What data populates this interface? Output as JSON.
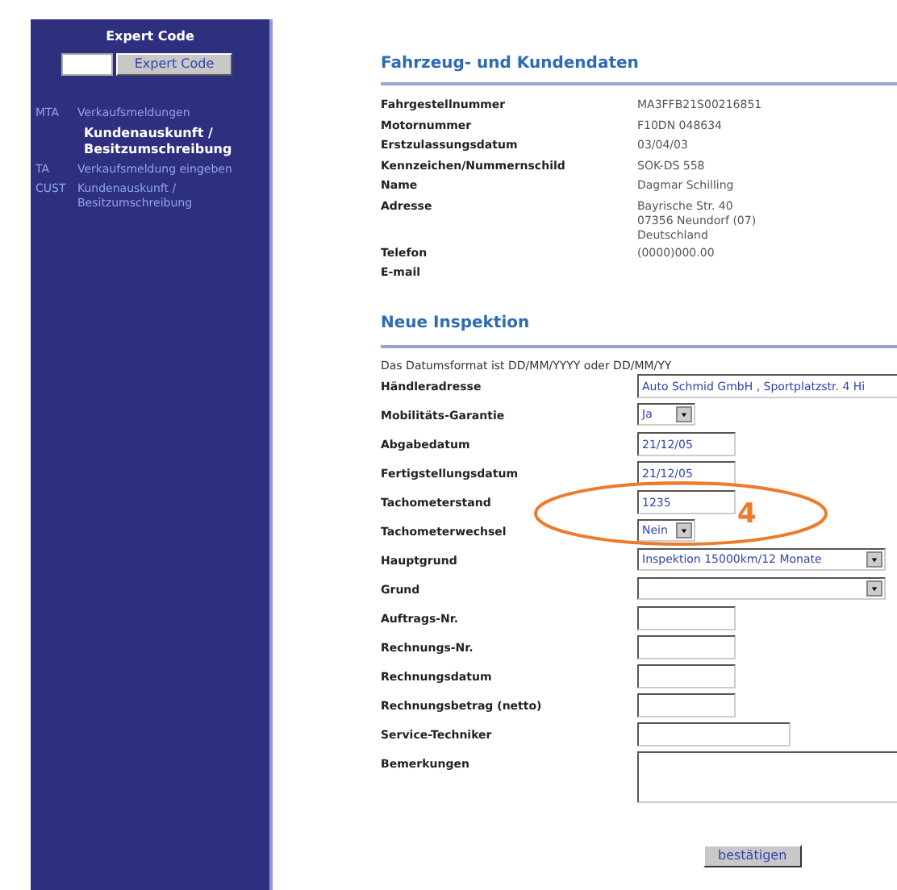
{
  "sidebar": {
    "heading": "Expert Code",
    "button": "Expert Code",
    "items": [
      {
        "code": "MTA",
        "label": "Verkaufsmeldungen",
        "selected": false
      },
      {
        "label": "Kundenauskunft / Besitzumschreibung",
        "selected": true
      },
      {
        "code": "TA",
        "label": "Verkaufsmeldung eingeben",
        "selected": false
      },
      {
        "code": "CUST",
        "label": "Kundenauskunft / Besitzumschreibung",
        "selected": false
      }
    ]
  },
  "vehicle": {
    "title": "Fahrzeug- und Kundendaten",
    "rows": [
      {
        "label": "Fahrgestellnummer",
        "value": [
          "MA3FFB21S00216851"
        ]
      },
      {
        "label": "Motornummer",
        "value": [
          "F10DN 048634"
        ]
      },
      {
        "label": "Erstzulassungsdatum",
        "value": [
          "03/04/03"
        ]
      },
      {
        "label": "Kennzeichen/Nummernschild",
        "value": [
          "SOK-DS 558"
        ]
      },
      {
        "label": "Name",
        "value": [
          "Dagmar Schilling"
        ]
      },
      {
        "label": "Adresse",
        "value": [
          "Bayrische Str. 40",
          "07356 Neundorf (07)",
          "Deutschland"
        ]
      },
      {
        "label": "Telefon",
        "value": [
          "(0000)000.00"
        ]
      },
      {
        "label": "E-mail",
        "value": []
      }
    ]
  },
  "inspection": {
    "title": "Neue Inspektion",
    "note": "Das Datumsformat ist DD/MM/YYYY oder DD/MM/YY",
    "fields": [
      {
        "label": "Händleradresse",
        "kind": "wide",
        "value": "Auto Schmid GmbH , Sportplatzstr. 4 Hi"
      },
      {
        "label": "Mobilitäts-Garantie",
        "kind": "select",
        "value": "Ja"
      },
      {
        "label": "Abgabedatum",
        "kind": "text",
        "value": "21/12/05"
      },
      {
        "label": "Fertigstellungsdatum",
        "kind": "text",
        "value": "21/12/05"
      },
      {
        "label": "Tachometerstand",
        "kind": "text",
        "value": "1235"
      },
      {
        "label": "Tachometerwechsel",
        "kind": "select",
        "value": "Nein"
      },
      {
        "label": "Hauptgrund",
        "kind": "longselect",
        "value": "Inspektion 15000km/12 Monate"
      },
      {
        "label": "Grund",
        "kind": "longselect"
      },
      {
        "label": "Auftrags-Nr.",
        "kind": "text"
      },
      {
        "label": "Rechnungs-Nr.",
        "kind": "text"
      },
      {
        "label": "Rechnungsdatum",
        "kind": "text"
      },
      {
        "label": "Rechnungsbetrag (netto)",
        "kind": "text"
      },
      {
        "label": "Service-Techniker",
        "kind": "medium"
      },
      {
        "label": "Bemerkungen",
        "kind": "textarea"
      }
    ],
    "button": "bestätigen"
  },
  "annotation": {
    "label": "4"
  }
}
